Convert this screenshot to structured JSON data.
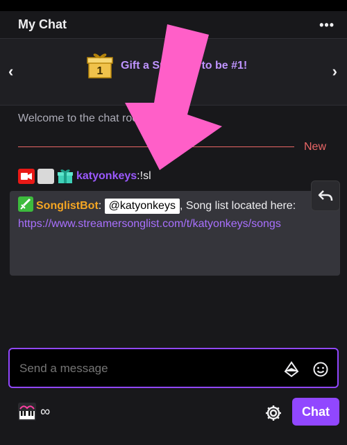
{
  "header": {
    "title": "My Chat",
    "more_label": "•••"
  },
  "banner": {
    "prev_label": "‹",
    "next_label": "›",
    "cta_text": "Gift a Sub now to be #1!",
    "gift_rank": "1"
  },
  "chat": {
    "welcome_text": "Welcome to the chat room!",
    "new_label": "New",
    "message1": {
      "username": "katyonkeys",
      "separator": ": ",
      "text": "!sl"
    },
    "message2": {
      "username": "SonglistBot",
      "separator": ": ",
      "mention": "@katyonkeys",
      "text": ", Song list located here:",
      "link": "https://www.streamersonglist.com/t/katyonkeys/songs"
    }
  },
  "input": {
    "placeholder": "Send a message"
  },
  "footer": {
    "points_value": "∞",
    "chat_button_label": "Chat"
  },
  "colors": {
    "accent": "#9147ff",
    "new_divider": "#eb6767",
    "arrow": "#ff5fc8"
  },
  "icons": [
    "more-icon",
    "chevron-left-icon",
    "chevron-right-icon",
    "gift-icon",
    "camera-badge-icon",
    "grid-badge-icon",
    "gift-badge-icon",
    "sword-badge-icon",
    "reply-icon",
    "bits-icon",
    "emote-icon",
    "channel-points-icon",
    "gear-icon",
    "annotation-arrow"
  ]
}
